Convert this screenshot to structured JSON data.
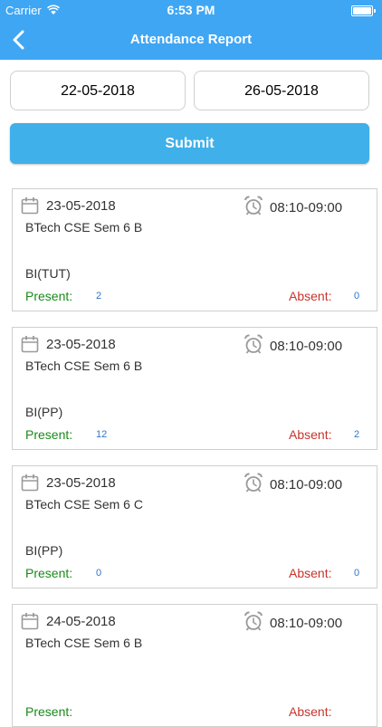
{
  "status_bar": {
    "carrier": "Carrier",
    "time": "6:53 PM"
  },
  "nav": {
    "title": "Attendance Report",
    "back_icon": "chevron-left-icon"
  },
  "filters": {
    "start_date": "22-05-2018",
    "end_date": "26-05-2018",
    "submit_label": "Submit"
  },
  "colors": {
    "accent": "#3fa6f4",
    "submit": "#3fb0e9",
    "present": "#1a8a1a",
    "absent": "#c8332b",
    "count": "#2f76c8"
  },
  "labels": {
    "present": "Present:",
    "absent": "Absent:"
  },
  "records": [
    {
      "date": "23-05-2018",
      "time": "08:10-09:00",
      "class": "BTech CSE Sem 6 B",
      "subject": "BI(TUT)",
      "present": "2",
      "absent": "0"
    },
    {
      "date": "23-05-2018",
      "time": "08:10-09:00",
      "class": "BTech CSE Sem 6 B",
      "subject": "BI(PP)",
      "present": "12",
      "absent": "2"
    },
    {
      "date": "23-05-2018",
      "time": "08:10-09:00",
      "class": "BTech CSE Sem 6 C",
      "subject": "BI(PP)",
      "present": "0",
      "absent": "0"
    },
    {
      "date": "24-05-2018",
      "time": "08:10-09:00",
      "class": "BTech CSE Sem 6 B",
      "subject": "",
      "present": "",
      "absent": ""
    }
  ]
}
